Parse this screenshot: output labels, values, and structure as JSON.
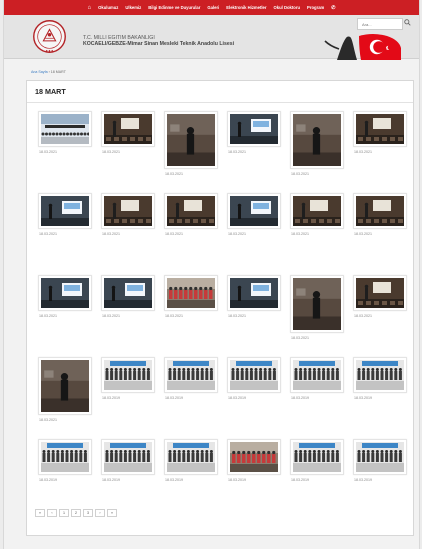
{
  "nav": {
    "items": [
      "Okulumuz",
      "Ulkemiz",
      "Bilgi Edinme ve Duyurular",
      "Galeri",
      "Elektronik Hizmetler",
      "Okul Doktoru",
      "Program"
    ],
    "home_icon": "home-icon",
    "phone_icon": "phone-icon"
  },
  "header": {
    "line1": "T.C. MILLI EGITIM BAKANLIGI",
    "line2": "KOCAELI/GEBZE-Mimar Sinan Mesleki Teknik Anadolu Lisesi",
    "search_placeholder": "Ara...",
    "logo_icon": "meb-logo",
    "flag_icon": "turkish-flag"
  },
  "breadcrumb": {
    "home": "Ana Sayfa",
    "separator": "›",
    "current": "18 MART"
  },
  "page": {
    "title": "18 MART"
  },
  "gallery": [
    {
      "date": "18.03.2021",
      "kind": "classroom-wide",
      "tall": false
    },
    {
      "date": "18.03.2021",
      "kind": "classroom-dark",
      "tall": false
    },
    {
      "date": "18.03.2021",
      "kind": "person-standing",
      "tall": true
    },
    {
      "date": "18.03.2021",
      "kind": "projector",
      "tall": false
    },
    {
      "date": "18.03.2021",
      "kind": "person-standing",
      "tall": true
    },
    {
      "date": "18.03.2021",
      "kind": "classroom-dark",
      "tall": false
    },
    {
      "date": "18.03.2021",
      "kind": "projector",
      "tall": false
    },
    {
      "date": "18.03.2021",
      "kind": "classroom-dark",
      "tall": false
    },
    {
      "date": "18.03.2021",
      "kind": "classroom-dark",
      "tall": false
    },
    {
      "date": "18.03.2021",
      "kind": "projector",
      "tall": false
    },
    {
      "date": "18.03.2021",
      "kind": "classroom-dark",
      "tall": false
    },
    {
      "date": "18.03.2021",
      "kind": "classroom-dark",
      "tall": false
    },
    {
      "date": "18.03.2021",
      "kind": "projector",
      "tall": false
    },
    {
      "date": "18.03.2021",
      "kind": "projector",
      "tall": false
    },
    {
      "date": "18.03.2021",
      "kind": "group",
      "tall": false
    },
    {
      "date": "18.03.2021",
      "kind": "projector",
      "tall": false
    },
    {
      "date": "18.03.2021",
      "kind": "person-standing",
      "tall": true
    },
    {
      "date": "18.03.2021",
      "kind": "classroom-dark",
      "tall": false
    },
    {
      "date": "18.03.2021",
      "kind": "person-standing",
      "tall": true
    },
    {
      "date": "18.03.2019",
      "kind": "group-banner",
      "tall": false
    },
    {
      "date": "18.03.2019",
      "kind": "group-banner",
      "tall": false
    },
    {
      "date": "18.03.2019",
      "kind": "group-banner",
      "tall": false
    },
    {
      "date": "18.03.2019",
      "kind": "group-banner",
      "tall": false
    },
    {
      "date": "18.03.2019",
      "kind": "group-banner",
      "tall": false
    },
    {
      "date": "18.03.2019",
      "kind": "group-banner",
      "tall": false
    },
    {
      "date": "18.03.2019",
      "kind": "group-banner",
      "tall": false
    },
    {
      "date": "18.03.2019",
      "kind": "group-banner",
      "tall": false
    },
    {
      "date": "18.03.2019",
      "kind": "group",
      "tall": false
    },
    {
      "date": "18.03.2019",
      "kind": "group-banner",
      "tall": false
    },
    {
      "date": "18.03.2019",
      "kind": "group-banner",
      "tall": false
    }
  ],
  "pagination": [
    "«",
    "‹",
    "1",
    "2",
    "3",
    "›",
    "»"
  ],
  "colors": {
    "nav_red": "#cc1f24",
    "flag_red": "#e30a17",
    "link_blue": "#3a7bc2"
  }
}
